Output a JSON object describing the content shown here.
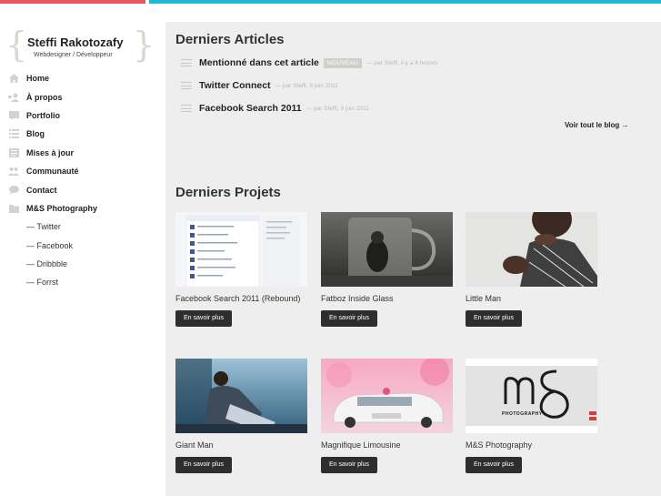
{
  "brand": {
    "name": "Steffi Rakotozafy",
    "subtitle": "Webdesigner / Développeur",
    "brace_open": "{",
    "brace_close": "}"
  },
  "nav": {
    "items": [
      {
        "label": "Home",
        "icon": "home-icon"
      },
      {
        "label": "À propos",
        "icon": "user-icon"
      },
      {
        "label": "Portfolio",
        "icon": "portfolio-icon"
      },
      {
        "label": "Blog",
        "icon": "blog-icon"
      },
      {
        "label": "Mises à jour",
        "icon": "updates-icon"
      },
      {
        "label": "Communauté",
        "icon": "community-icon"
      },
      {
        "label": "Contact",
        "icon": "chat-icon"
      },
      {
        "label": "M&S Photography",
        "icon": "folder-icon"
      }
    ],
    "social": [
      {
        "label": "— Twitter"
      },
      {
        "label": "— Facebook"
      },
      {
        "label": "— Dribbble"
      },
      {
        "label": "— Forrst"
      }
    ]
  },
  "articles_section": {
    "title": "Derniers Articles",
    "items": [
      {
        "title": "Mentionné dans cet article",
        "badge": "Nouveau",
        "meta": "— par Steffi, il y a 4 heures"
      },
      {
        "title": "Twitter Connect",
        "badge": "",
        "meta": "— par Steffi, 9 juin 2011"
      },
      {
        "title": "Facebook Search 2011",
        "badge": "",
        "meta": "— par Steffi, 9 juin 2011"
      }
    ],
    "blog_link": "Voir tout le blog →"
  },
  "projects_section": {
    "title": "Derniers Projets",
    "button_label": "En savoir plus",
    "items": [
      {
        "title": "Facebook Search 2011 (Rebound)"
      },
      {
        "title": "Fatboz Inside Glass"
      },
      {
        "title": "Little Man"
      },
      {
        "title": "Giant Man"
      },
      {
        "title": "Magnifique Limousine"
      },
      {
        "title": "M&S Photography",
        "logo_text": "PHOTOGRAPHY"
      }
    ]
  },
  "colors": {
    "accent_red": "#e9555a",
    "accent_cyan": "#1fb8d8",
    "button_bg": "#2e2e2e",
    "main_bg": "#eeeeee"
  }
}
